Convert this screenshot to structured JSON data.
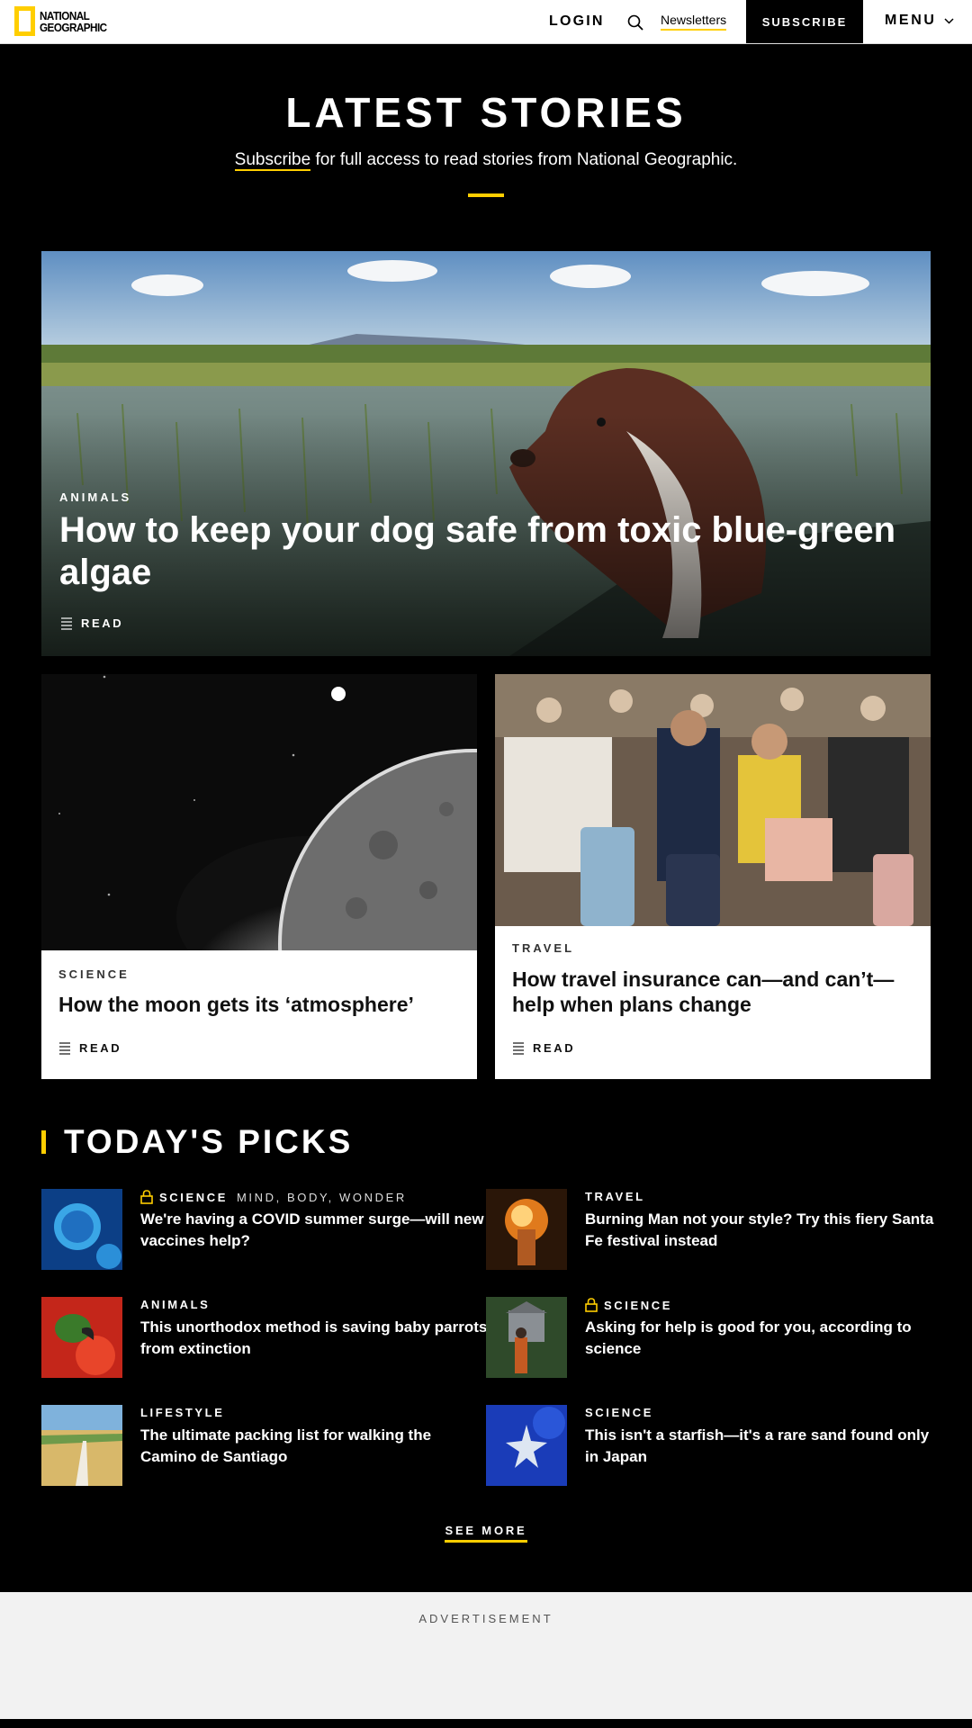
{
  "header": {
    "logo_text": "NATIONAL GEOGRAPHIC",
    "login_label": "LOGIN",
    "newsletters_label": "Newsletters",
    "subscribe_label": "SUBSCRIBE",
    "menu_label": "MENU"
  },
  "latest": {
    "title": "LATEST STORIES",
    "subscribe_link": "Subscribe",
    "subscribe_text": " for full access to read stories from National Geographic."
  },
  "hero": {
    "category": "ANIMALS",
    "title": "How to keep your dog safe from toxic blue-green algae",
    "read_label": "READ"
  },
  "cards": [
    {
      "category": "SCIENCE",
      "title": "How the moon gets its ‘atmosphere’",
      "read_label": "READ"
    },
    {
      "category": "TRAVEL",
      "title": "How travel insurance can—and can’t—help when plans change",
      "read_label": "READ"
    }
  ],
  "picks": {
    "title": "TODAY'S PICKS",
    "items": [
      {
        "category": "SCIENCE",
        "subcategory": "MIND, BODY, WONDER",
        "locked": true,
        "title": "We're having a COVID summer surge—will new vaccines help?"
      },
      {
        "category": "TRAVEL",
        "subcategory": "",
        "locked": false,
        "title": "Burning Man not your style? Try this fiery Santa Fe festival instead"
      },
      {
        "category": "ANIMALS",
        "subcategory": "",
        "locked": false,
        "title": "This unorthodox method is saving baby parrots from extinction"
      },
      {
        "category": "SCIENCE",
        "subcategory": "",
        "locked": true,
        "title": "Asking for help is good for you, according to science"
      },
      {
        "category": "LIFESTYLE",
        "subcategory": "",
        "locked": false,
        "title": "The ultimate packing list for walking the Camino de Santiago"
      },
      {
        "category": "SCIENCE",
        "subcategory": "",
        "locked": false,
        "title": "This isn't a starfish—it's a rare sand found only in Japan"
      }
    ],
    "see_more_label": "SEE MORE"
  },
  "ad": {
    "label": "ADVERTISEMENT"
  },
  "colors": {
    "brand_yellow": "#ffce00",
    "background": "#000000",
    "ad_background": "#f2f2f2"
  },
  "icons": [
    "search-icon",
    "chevron-down-icon",
    "article-read-icon",
    "lock-icon"
  ]
}
